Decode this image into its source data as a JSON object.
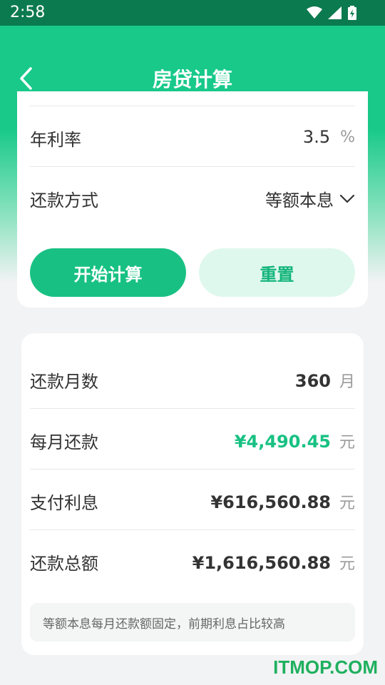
{
  "status_bar": {
    "time": "2:58"
  },
  "header": {
    "title": "房贷计算"
  },
  "form": {
    "rate": {
      "label": "年利率",
      "value": "3.5",
      "unit": "%"
    },
    "method": {
      "label": "还款方式",
      "value": "等额本息"
    },
    "calc_button": "开始计算",
    "reset_button": "重置"
  },
  "results": {
    "months": {
      "label": "还款月数",
      "value": "360",
      "unit": "月"
    },
    "monthly": {
      "label": "每月还款",
      "value": "¥4,490.45",
      "unit": "元"
    },
    "interest": {
      "label": "支付利息",
      "value": "¥616,560.88",
      "unit": "元"
    },
    "total": {
      "label": "还款总额",
      "value": "¥1,616,560.88",
      "unit": "元"
    },
    "note": "等额本息每月还款额固定，前期利息占比较高"
  },
  "watermark": "ITMOP.COM",
  "colors": {
    "primary": "#18c183",
    "status_bar": "#0b7a4f",
    "highlight": "#18c183"
  }
}
